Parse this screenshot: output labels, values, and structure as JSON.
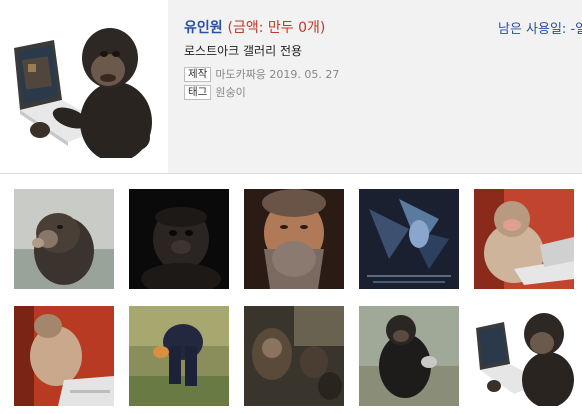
{
  "package": {
    "name": "유인원",
    "price": "(금액: 만두 0개)",
    "remaining_label": "남은 사용일: -일",
    "description": "로스트아크 갤러리 전용",
    "maker_label": "제작",
    "maker_value": "마도카짜응 2019. 05. 27",
    "tag_label": "태그",
    "tag_value": "원숭이"
  },
  "emoticons": [
    {
      "subject": "chimp-blowing-kiss"
    },
    {
      "subject": "gorilla-face-dark"
    },
    {
      "subject": "bearded-man-face"
    },
    {
      "subject": "dragon-game-scene"
    },
    {
      "subject": "baboon-at-laptop"
    },
    {
      "subject": "monkey-smashing-laptop"
    },
    {
      "subject": "chimp-bending-over"
    },
    {
      "subject": "apes-in-vehicle"
    },
    {
      "subject": "chimp-sitting"
    },
    {
      "subject": "chimp-with-laptop"
    }
  ]
}
